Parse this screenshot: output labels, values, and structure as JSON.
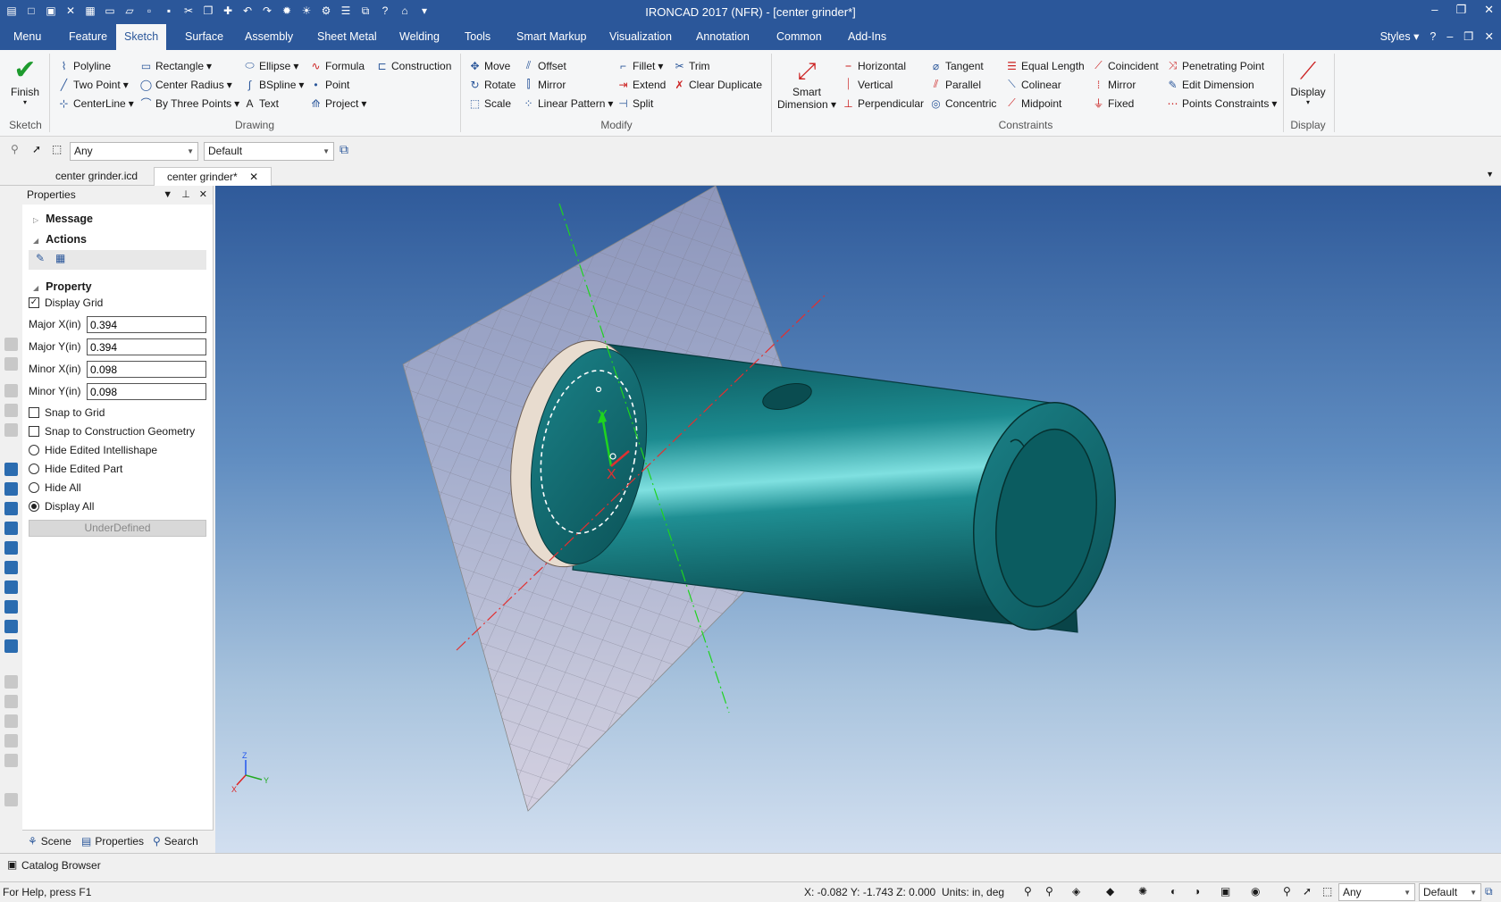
{
  "window": {
    "title": "IRONCAD 2017 (NFR) - [center grinder*]"
  },
  "ribbon_tabs": [
    "Menu",
    "Feature",
    "Sketch",
    "Surface",
    "Assembly",
    "Sheet Metal",
    "Welding",
    "Tools",
    "Smart Markup",
    "Visualization",
    "Annotation",
    "Common",
    "Add-Ins"
  ],
  "ribbon_active_tab": "Sketch",
  "ribbon_right": {
    "styles": "Styles"
  },
  "sketch_group": {
    "finish": "Finish",
    "label": "Sketch"
  },
  "drawing": {
    "label": "Drawing",
    "polyline": "Polyline",
    "rectangle": "Rectangle",
    "ellipse": "Ellipse",
    "formula": "Formula",
    "construction": "Construction",
    "two_point": "Two Point",
    "center_radius": "Center Radius",
    "bspline": "BSpline",
    "point": "Point",
    "centerline": "CenterLine",
    "by_three_points": "By Three Points",
    "text": "Text",
    "project": "Project"
  },
  "modify": {
    "label": "Modify",
    "move": "Move",
    "offset": "Offset",
    "fillet": "Fillet",
    "trim": "Trim",
    "rotate": "Rotate",
    "mirror": "Mirror",
    "extend": "Extend",
    "clear_duplicate": "Clear Duplicate",
    "scale": "Scale",
    "linear_pattern": "Linear Pattern",
    "split": "Split"
  },
  "constraints": {
    "label": "Constraints",
    "smart_dimension_1": "Smart",
    "smart_dimension_2": "Dimension",
    "horizontal": "Horizontal",
    "tangent": "Tangent",
    "equal_length": "Equal Length",
    "coincident": "Coincident",
    "penetrating_point": "Penetrating Point",
    "vertical": "Vertical",
    "parallel": "Parallel",
    "colinear": "Colinear",
    "mirror": "Mirror",
    "edit_dimension": "Edit Dimension",
    "perpendicular": "Perpendicular",
    "concentric": "Concentric",
    "midpoint": "Midpoint",
    "fixed": "Fixed",
    "points_constraints": "Points Constraints"
  },
  "display_group": {
    "button": "Display",
    "label": "Display"
  },
  "toolbar": {
    "filter": "Any",
    "style": "Default"
  },
  "doc_tabs": [
    "center grinder.icd",
    "center grinder*"
  ],
  "properties": {
    "title": "Properties",
    "message": "Message",
    "actions": "Actions",
    "property": "Property",
    "display_grid": "Display Grid",
    "major_x_label": "Major X(in)",
    "major_x": "0.394",
    "major_y_label": "Major Y(in)",
    "major_y": "0.394",
    "minor_x_label": "Minor X(in)",
    "minor_x": "0.098",
    "minor_y_label": "Minor Y(in)",
    "minor_y": "0.098",
    "snap_grid": "Snap to Grid",
    "snap_construction": "Snap to Construction Geometry",
    "hide_intellishape": "Hide Edited Intellishape",
    "hide_part": "Hide Edited Part",
    "hide_all": "Hide All",
    "display_all": "Display All",
    "status": "UnderDefined"
  },
  "panel_tabs": [
    "Scene",
    "Properties",
    "Search"
  ],
  "catalog": "Catalog Browser",
  "status": {
    "help": "For Help, press F1",
    "coords": "X: -0.082 Y: -1.743 Z: 0.000",
    "units": "Units: in, deg",
    "filter": "Any",
    "style": "Default"
  },
  "axes": {
    "x": "X",
    "y": "Y",
    "z": "Z"
  }
}
